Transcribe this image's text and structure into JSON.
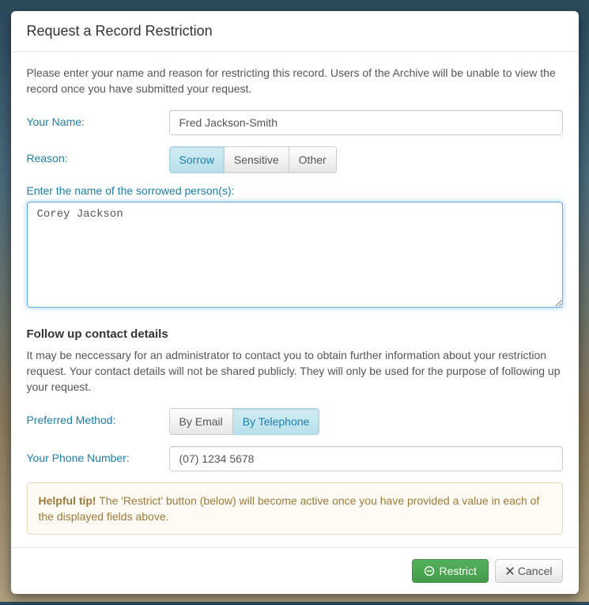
{
  "header": {
    "title": "Request a Record Restriction"
  },
  "intro": "Please enter your name and reason for restricting this record. Users of the Archive will be unable to view the record once you have submitted your request.",
  "form": {
    "name_label": "Your Name:",
    "name_value": "Fred Jackson-Smith",
    "reason_label": "Reason:",
    "reason_options": {
      "sorrow": "Sorrow",
      "sensitive": "Sensitive",
      "other": "Other"
    },
    "reason_selected": "sorrow",
    "sorrowed_label": "Enter the name of the sorrowed person(s):",
    "sorrowed_value": "Corey Jackson"
  },
  "followup": {
    "heading": "Follow up contact details",
    "text": "It may be neccessary for an administrator to contact you to obtain further information about your restriction request. Your contact details will not be shared publicly. They will only be used for the purpose of following up your request.",
    "method_label": "Preferred Method:",
    "method_options": {
      "email": "By Email",
      "telephone": "By Telephone"
    },
    "method_selected": "telephone",
    "phone_label": "Your Phone Number:",
    "phone_value": "(07) 1234 5678"
  },
  "tip": {
    "strong": "Helpful tip!",
    "text": " The 'Restrict' button (below) will become active once you have provided a value in each of the displayed fields above."
  },
  "footer": {
    "restrict_label": "Restrict",
    "cancel_label": "Cancel"
  }
}
